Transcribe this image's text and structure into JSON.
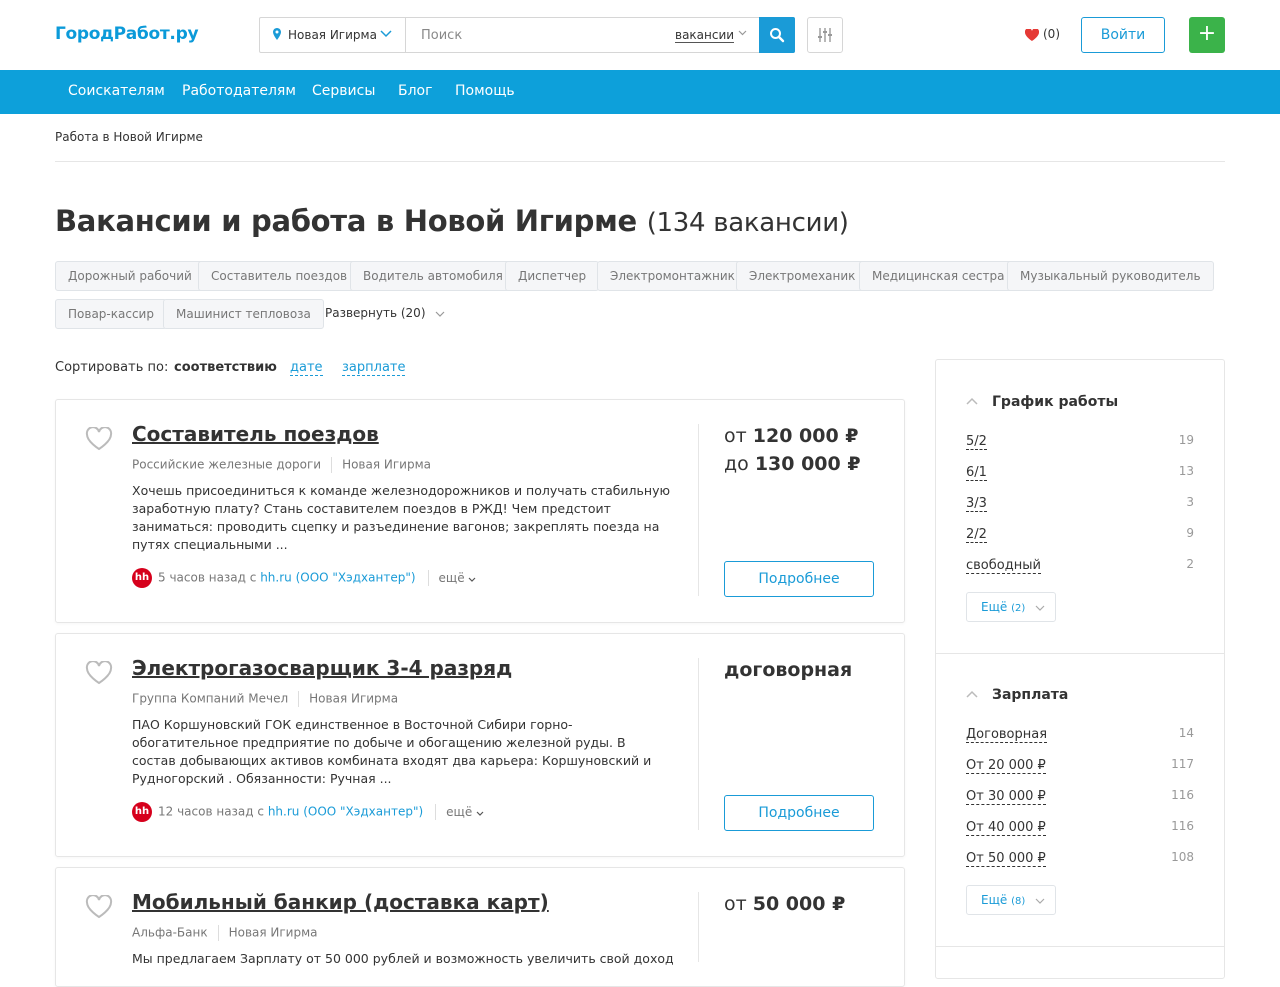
{
  "header": {
    "logo": "ГородРабот.ру",
    "city": "Новая Игирма",
    "search_placeholder": "Поиск",
    "search_kind": "вакансии",
    "favorites_count": "(0)",
    "login_label": "Войти",
    "add_label": "+"
  },
  "nav": [
    "Соискателям",
    "Работодателям",
    "Сервисы",
    "Блог",
    "Помощь"
  ],
  "breadcrumb": "Работа в Новой Игирме",
  "page": {
    "title": "Вакансии и работа в Новой Игирме",
    "count": "(134 вакансии)"
  },
  "tags": [
    "Дорожный рабочий",
    "Составитель поездов",
    "Водитель автомобиля",
    "Диспетчер",
    "Электромонтажник",
    "Электромеханик",
    "Медицинская сестра",
    "Музыкальный руководитель",
    "Повар-кассир",
    "Машинист тепловоза"
  ],
  "expand_label": "Развернуть (20)",
  "sort": {
    "label": "Сортировать по:",
    "current": "соответствию",
    "options": [
      "дате",
      "зарплате"
    ]
  },
  "vacancies": [
    {
      "title": "Составитель поездов",
      "company": "Российские железные дороги",
      "city": "Новая Игирма",
      "description": "Хочешь присоединиться к команде железнодорожников и получать стабильную заработную плату? Стань составителем поездов в РЖД! Чем предстоит заниматься: проводить сцепку и разъединение вагонов; закреплять поезда на путях специальными ...",
      "time": "5 часов назад с",
      "source": "hh.ru (ООО \"Хэдхантер\")",
      "more": "ещё",
      "salary_from_prefix": "от",
      "salary_from": "120 000 ₽",
      "salary_to_prefix": "до",
      "salary_to": "130 000 ₽",
      "button": "Подробнее"
    },
    {
      "title": "Электрогазосварщик 3-4 разряд",
      "company": "Группа Компаний Мечел",
      "city": "Новая Игирма",
      "description": "ПАО Коршуновский ГОК единственное в Восточной Сибири горно-обогатительное предприятие по добыче и обогащению железной руды. В состав добывающих активов комбината входят два карьера: Коршуновский и Рудногорский . Обязанности: Ручная ...",
      "time": "12 часов назад с",
      "source": "hh.ru (ООО \"Хэдхантер\")",
      "more": "ещё",
      "salary": "договорная",
      "button": "Подробнее"
    },
    {
      "title": "Мобильный банкир (доставка карт)",
      "company": "Альфа-Банк",
      "city": "Новая Игирма",
      "description": "Мы предлагаем Зарплату от 50 000 рублей и возможность увеличить свой доход",
      "salary_from_prefix": "от",
      "salary_from": "50 000 ₽"
    }
  ],
  "sidebar": {
    "schedule": {
      "title": "График работы",
      "items": [
        {
          "label": "5/2",
          "count": "19"
        },
        {
          "label": "6/1",
          "count": "13"
        },
        {
          "label": "3/3",
          "count": "3"
        },
        {
          "label": "2/2",
          "count": "9"
        },
        {
          "label": "свободный",
          "count": "2"
        }
      ],
      "more_label": "Ещё",
      "more_count": "(2)"
    },
    "salary": {
      "title": "Зарплата",
      "items": [
        {
          "label": "Договорная",
          "count": "14"
        },
        {
          "label": "От 20 000 ₽",
          "count": "117"
        },
        {
          "label": "От 30 000 ₽",
          "count": "116"
        },
        {
          "label": "От 40 000 ₽",
          "count": "116"
        },
        {
          "label": "От 50 000 ₽",
          "count": "108"
        }
      ],
      "more_label": "Ещё",
      "more_count": "(8)"
    }
  },
  "colors": {
    "brand_blue": "#0da0da",
    "accent_blue": "#1a9bd7",
    "green": "#3bb34a",
    "hh_red": "#d6001c",
    "heart_red": "#e53935"
  }
}
